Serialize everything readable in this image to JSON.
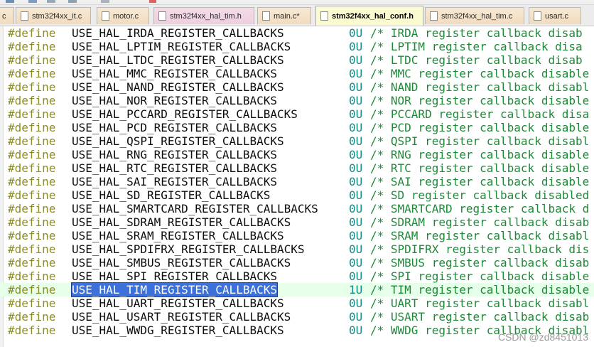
{
  "tabs": [
    {
      "label": "c",
      "kind": "c",
      "active": false
    },
    {
      "label": "stm32f4xx_it.c",
      "kind": "c",
      "active": false
    },
    {
      "label": "motor.c",
      "kind": "c",
      "active": false
    },
    {
      "label": "stm32f4xx_hal_tim.h",
      "kind": "h",
      "active": false
    },
    {
      "label": "main.c*",
      "kind": "c",
      "active": false
    },
    {
      "label": "stm32f4xx_hal_conf.h",
      "kind": "h",
      "active": true
    },
    {
      "label": "stm32f4xx_hal_tim.c",
      "kind": "c",
      "active": false
    },
    {
      "label": "usart.c",
      "kind": "c",
      "active": false
    }
  ],
  "code": {
    "lines": [
      {
        "kw": "#define",
        "name": "USE_HAL_IRDA_REGISTER_CALLBACKS",
        "value": "0U",
        "comment": "/* IRDA register callback disab"
      },
      {
        "kw": "#define",
        "name": "USE_HAL_LPTIM_REGISTER_CALLBACKS",
        "value": "0U",
        "comment": "/* LPTIM register callback disa"
      },
      {
        "kw": "#define",
        "name": "USE_HAL_LTDC_REGISTER_CALLBACKS",
        "value": "0U",
        "comment": "/* LTDC register callback disab"
      },
      {
        "kw": "#define",
        "name": "USE_HAL_MMC_REGISTER_CALLBACKS",
        "value": "0U",
        "comment": "/* MMC register callback disable"
      },
      {
        "kw": "#define",
        "name": "USE_HAL_NAND_REGISTER_CALLBACKS",
        "value": "0U",
        "comment": "/* NAND register callback disabl"
      },
      {
        "kw": "#define",
        "name": "USE_HAL_NOR_REGISTER_CALLBACKS",
        "value": "0U",
        "comment": "/* NOR register callback disable"
      },
      {
        "kw": "#define",
        "name": "USE_HAL_PCCARD_REGISTER_CALLBACKS",
        "value": "0U",
        "comment": "/* PCCARD register callback disa"
      },
      {
        "kw": "#define",
        "name": "USE_HAL_PCD_REGISTER_CALLBACKS",
        "value": "0U",
        "comment": "/* PCD register callback disable"
      },
      {
        "kw": "#define",
        "name": "USE_HAL_QSPI_REGISTER_CALLBACKS",
        "value": "0U",
        "comment": "/* QSPI register callback disabl"
      },
      {
        "kw": "#define",
        "name": "USE_HAL_RNG_REGISTER_CALLBACKS",
        "value": "0U",
        "comment": "/* RNG register callback disable"
      },
      {
        "kw": "#define",
        "name": "USE_HAL_RTC_REGISTER_CALLBACKS",
        "value": "0U",
        "comment": "/* RTC register callback disable"
      },
      {
        "kw": "#define",
        "name": "USE_HAL_SAI_REGISTER_CALLBACKS",
        "value": "0U",
        "comment": "/* SAI register callback disable"
      },
      {
        "kw": "#define",
        "name": "USE_HAL_SD_REGISTER_CALLBACKS",
        "value": "0U",
        "comment": "/* SD register callback disabled"
      },
      {
        "kw": "#define",
        "name": "USE_HAL_SMARTCARD_REGISTER_CALLBACKS",
        "value": "0U",
        "comment": "/* SMARTCARD register callback d"
      },
      {
        "kw": "#define",
        "name": "USE_HAL_SDRAM_REGISTER_CALLBACKS",
        "value": "0U",
        "comment": "/* SDRAM register callback disab"
      },
      {
        "kw": "#define",
        "name": "USE_HAL_SRAM_REGISTER_CALLBACKS",
        "value": "0U",
        "comment": "/* SRAM register callback disabl"
      },
      {
        "kw": "#define",
        "name": "USE_HAL_SPDIFRX_REGISTER_CALLBACKS",
        "value": "0U",
        "comment": "/* SPDIFRX register callback dis"
      },
      {
        "kw": "#define",
        "name": "USE_HAL_SMBUS_REGISTER_CALLBACKS",
        "value": "0U",
        "comment": "/* SMBUS register callback disab"
      },
      {
        "kw": "#define",
        "name": "USE_HAL_SPI_REGISTER_CALLBACKS",
        "value": "0U",
        "comment": "/* SPI register callback disable"
      },
      {
        "kw": "#define",
        "name": "USE_HAL_TIM_REGISTER_CALLBACKS",
        "value": "1U",
        "comment": "/* TIM register callback disable",
        "selected": true
      },
      {
        "kw": "#define",
        "name": "USE_HAL_UART_REGISTER_CALLBACKS",
        "value": "0U",
        "comment": "/* UART register callback disabl"
      },
      {
        "kw": "#define",
        "name": "USE_HAL_USART_REGISTER_CALLBACKS",
        "value": "0U",
        "comment": "/* USART register callback disab"
      },
      {
        "kw": "#define",
        "name": "USE_HAL_WWDG_REGISTER_CALLBACKS",
        "value": "0U",
        "comment": "/* WWDG register callback disabl"
      }
    ]
  },
  "watermark": "CSDN @zd8451013",
  "colors": {
    "keyword": "#8c8c28",
    "value": "#148a87",
    "comment": "#1e8a38",
    "selection": "#3b71d8",
    "current_line": "#e5ffe9",
    "active_tab": "#fbfbd2"
  }
}
